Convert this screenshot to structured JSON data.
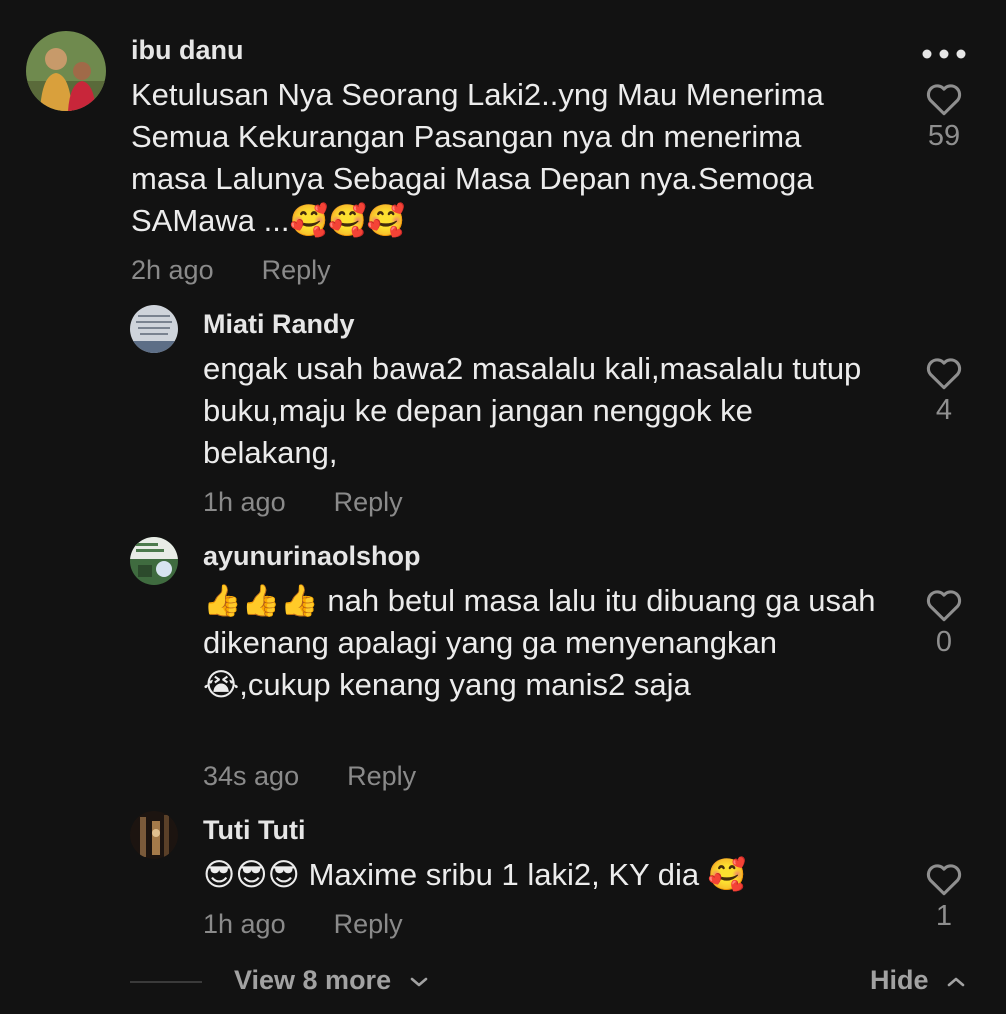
{
  "comments": [
    {
      "username": "ibu danu",
      "text": "Ketulusan Nya Seorang Laki2..yng Mau Menerima Semua Kekurangan Pasangan nya dn menerima masa Lalunya Sebagai Masa Depan nya.Semoga SAMawa ...🥰🥰🥰",
      "time": "2h ago",
      "reply_label": "Reply",
      "likes": "59",
      "avatar_icon": "user-photo-avatar"
    },
    {
      "username": "Miati Randy",
      "text": "engak usah bawa2 masalalu kali,masalalu tutup buku,maju ke depan jangan nenggok ke belakang,",
      "time": "1h ago",
      "reply_label": "Reply",
      "likes": "4",
      "avatar_icon": "text-image-avatar"
    },
    {
      "username": "ayunurinaolshop",
      "text": "👍👍👍 nah betul masa lalu itu dibuang ga usah dikenang apalagi yang ga menyenangkan😭,cukup kenang yang manis2 saja",
      "time": "34s ago",
      "reply_label": "Reply",
      "likes": "0",
      "avatar_icon": "shop-logo-avatar"
    },
    {
      "username": "Tuti Tuti",
      "text": "😎😎😎 Maxime sribu 1 laki2, KY dia 🥰",
      "time": "1h ago",
      "reply_label": "Reply",
      "likes": "1",
      "avatar_icon": "dark-photo-avatar"
    }
  ],
  "footer": {
    "view_more_label": "View 8 more",
    "hide_label": "Hide"
  },
  "colors": {
    "background": "#121212",
    "text": "#ececec",
    "muted": "#8a8a8a"
  },
  "icons": {
    "more": "more-horizontal-icon",
    "like": "heart-outline-icon",
    "expand": "chevron-down-icon",
    "collapse": "chevron-up-icon"
  }
}
